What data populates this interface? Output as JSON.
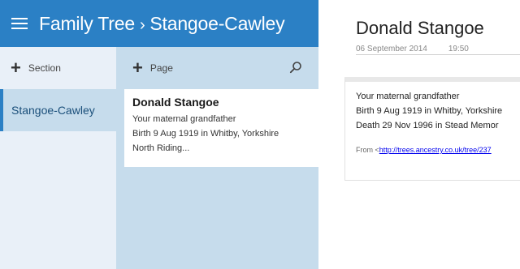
{
  "header": {
    "notebook": "Family Tree",
    "separator": "›",
    "section": "Stangoe-Cawley"
  },
  "sections_panel": {
    "add_label": "Section",
    "items": [
      {
        "label": "Stangoe-Cawley",
        "selected": true
      }
    ]
  },
  "pages_panel": {
    "add_label": "Page",
    "search_icon": "search-icon",
    "items": [
      {
        "title": "Donald Stangoe",
        "lines": [
          "Your maternal grandfather",
          "Birth 9 Aug 1919 in Whitby, Yorkshire",
          "North Riding..."
        ]
      }
    ]
  },
  "note": {
    "title": "Donald Stangoe",
    "date": "06 September 2014",
    "time": "19:50",
    "body": [
      "Your maternal grandfather",
      "Birth 9 Aug 1919 in Whitby, Yorkshire",
      "Death 29 Nov 1996 in Stead Memor"
    ],
    "from_label": "From <",
    "from_link": "http://trees.ancestry.co.uk/tree/237"
  },
  "colors": {
    "accent": "#2b80c5",
    "section_bg": "#e9f0f8",
    "pages_bg": "#c6dcec"
  }
}
